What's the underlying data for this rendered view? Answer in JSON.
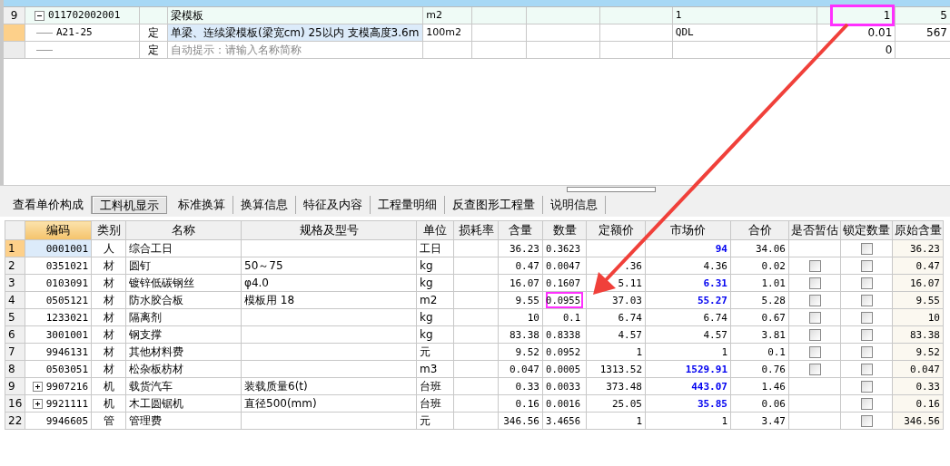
{
  "top_table": {
    "rows": [
      {
        "kind": "item",
        "num": "9",
        "expanded": true,
        "code": "011702002001",
        "name": "梁模板",
        "unit": "m2",
        "formula": "1",
        "qty": "1",
        "column_12": "5",
        "highlighted": true
      },
      {
        "kind": "quota",
        "code": "A21-25",
        "type": "定",
        "name": "单梁、连续梁模板(梁宽cm) 25以内 支模高度3.6m",
        "unit": "100m2",
        "formula": "QDL",
        "qty": "0.01",
        "column_12": "567",
        "highlighted": false
      },
      {
        "kind": "empty",
        "type": "定",
        "placeholder": "自动提示：请输入名称简称",
        "qty": "0",
        "highlighted": false
      }
    ]
  },
  "tabs": [
    {
      "label": "查看单价构成",
      "selected": false
    },
    {
      "label": "工料机显示",
      "selected": true
    },
    {
      "label": "标准换算",
      "selected": false
    },
    {
      "label": "换算信息",
      "selected": false
    },
    {
      "label": "特征及内容",
      "selected": false
    },
    {
      "label": "工程量明细",
      "selected": false
    },
    {
      "label": "反查图形工程量",
      "selected": false
    },
    {
      "label": "说明信息",
      "selected": false
    }
  ],
  "table": {
    "columns": [
      "编码",
      "类别",
      "名称",
      "规格及型号",
      "单位",
      "损耗率",
      "含量",
      "数量",
      "定额价",
      "市场价",
      "合价",
      "是否暂估",
      "锁定数量",
      "原始含量"
    ],
    "rows": [
      {
        "num": "1",
        "selected": true,
        "code": "0001001",
        "type": "人",
        "name": "综合工日",
        "unit": "工日",
        "content": "36.23",
        "qty": "0.3623",
        "market_price": "94",
        "market_changed": true,
        "total": "34.06",
        "locked": false,
        "original": "36.23",
        "highlighted": false
      },
      {
        "num": "2",
        "selected": false,
        "code": "0351021",
        "type": "材",
        "name": "圆钉",
        "spec": "50～75",
        "unit": "kg",
        "content": "0.47",
        "qty": "0.0047",
        "quota_price": ".36",
        "market_price": "4.36",
        "market_changed": false,
        "total": "0.02",
        "estimate": false,
        "locked": false,
        "original": "0.47",
        "highlighted": false
      },
      {
        "num": "3",
        "selected": false,
        "code": "0103091",
        "type": "材",
        "name": "镀锌低碳钢丝",
        "spec": "φ4.0",
        "unit": "kg",
        "content": "16.07",
        "qty": "0.1607",
        "quota_price": "5.11",
        "market_price": "6.31",
        "market_changed": true,
        "total": "1.01",
        "estimate": false,
        "locked": false,
        "original": "16.07",
        "highlighted": false
      },
      {
        "num": "4",
        "selected": false,
        "code": "0505121",
        "type": "材",
        "name": "防水胶合板",
        "spec": "模板用 18",
        "unit": "m2",
        "content": "9.55",
        "qty": "0.0955",
        "quota_price": "37.03",
        "market_price": "55.27",
        "market_changed": true,
        "total": "5.28",
        "estimate": false,
        "locked": false,
        "original": "9.55",
        "highlighted": true
      },
      {
        "num": "5",
        "selected": false,
        "code": "1233021",
        "type": "材",
        "name": "隔离剂",
        "unit": "kg",
        "content": "10",
        "qty": "0.1",
        "quota_price": "6.74",
        "market_price": "6.74",
        "market_changed": false,
        "total": "0.67",
        "estimate": false,
        "locked": false,
        "original": "10",
        "highlighted": false
      },
      {
        "num": "6",
        "selected": false,
        "code": "3001001",
        "type": "材",
        "name": "钢支撑",
        "unit": "kg",
        "content": "83.38",
        "qty": "0.8338",
        "quota_price": "4.57",
        "market_price": "4.57",
        "market_changed": false,
        "total": "3.81",
        "estimate": false,
        "locked": false,
        "original": "83.38",
        "highlighted": false
      },
      {
        "num": "7",
        "selected": false,
        "code": "9946131",
        "type": "材",
        "name": "其他材料费",
        "unit": "元",
        "content": "9.52",
        "qty": "0.0952",
        "quota_price": "1",
        "market_price": "1",
        "market_changed": false,
        "total": "0.1",
        "estimate": false,
        "locked": false,
        "original": "9.52",
        "highlighted": false
      },
      {
        "num": "8",
        "selected": false,
        "code": "0503051",
        "type": "材",
        "name": "松杂板枋材",
        "unit": "m3",
        "content": "0.047",
        "qty": "0.0005",
        "quota_price": "1313.52",
        "market_price": "1529.91",
        "market_changed": true,
        "total": "0.76",
        "estimate": false,
        "locked": false,
        "original": "0.047",
        "highlighted": false
      },
      {
        "num": "9",
        "selected": false,
        "expandable": true,
        "code": "9907216",
        "type": "机",
        "name": "载货汽车",
        "spec": "装载质量6(t)",
        "unit": "台班",
        "content": "0.33",
        "qty": "0.0033",
        "quota_price": "373.48",
        "market_price": "443.07",
        "market_changed": true,
        "total": "1.46",
        "locked": false,
        "original": "0.33",
        "highlighted": false
      },
      {
        "num": "16",
        "selected": false,
        "expandable": true,
        "code": "9921111",
        "type": "机",
        "name": "木工圆锯机",
        "spec": "直径500(mm)",
        "unit": "台班",
        "content": "0.16",
        "qty": "0.0016",
        "quota_price": "25.05",
        "market_price": "35.85",
        "market_changed": true,
        "total": "0.06",
        "locked": false,
        "original": "0.16",
        "highlighted": false
      },
      {
        "num": "22",
        "selected": false,
        "code": "9946605",
        "type": "管",
        "name": "管理费",
        "unit": "元",
        "content": "346.56",
        "qty": "3.4656",
        "quota_price": "1",
        "market_price": "1",
        "market_changed": false,
        "total": "3.47",
        "locked": false,
        "original": "346.56",
        "highlighted": false
      }
    ]
  }
}
